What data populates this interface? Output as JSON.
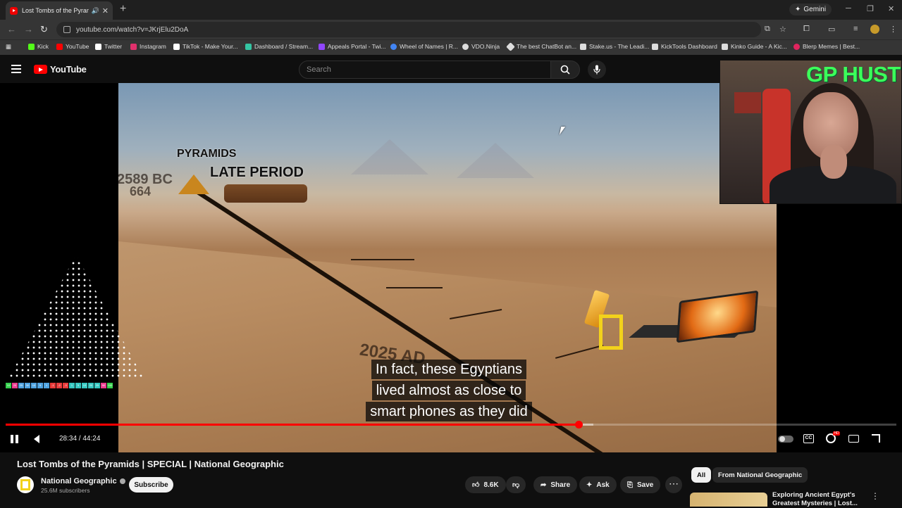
{
  "browser": {
    "tab_title": "Lost Tombs of the Pyramids",
    "gemini_label": "Gemini",
    "url": "youtube.com/watch?v=JKrjElu2DoA",
    "bookmarks": [
      {
        "label": "Kick",
        "color": "#53fc18"
      },
      {
        "label": "YouTube",
        "color": "#ff0000"
      },
      {
        "label": "Twitter",
        "color": "#ffffff"
      },
      {
        "label": "Instagram",
        "color": "#e1306c"
      },
      {
        "label": "TikTok - Make Your...",
        "color": "#ffffff"
      },
      {
        "label": "Dashboard / Stream...",
        "color": "#34c5a3"
      },
      {
        "label": "Appeals Portal - Twi...",
        "color": "#9146ff"
      },
      {
        "label": "Wheel of Names | R...",
        "color": "#4285f4"
      },
      {
        "label": "VDO.Ninja",
        "color": "#dddddd"
      },
      {
        "label": "The best ChatBot an...",
        "color": "#dddddd"
      },
      {
        "label": "Stake.us - The Leadi...",
        "color": "#dddddd"
      },
      {
        "label": "KickTools Dashboard",
        "color": "#dddddd"
      },
      {
        "label": "Kinko Guide - A Kic...",
        "color": "#dddddd"
      },
      {
        "label": "Blerp Memes | Best...",
        "color": "#e0245e"
      }
    ]
  },
  "youtube": {
    "logo_text": "YouTube",
    "search_placeholder": "Search"
  },
  "video": {
    "era_labels": [
      "PYRAMIDS",
      "LATE PERIOD"
    ],
    "year_labels": [
      "2589 BC",
      "664",
      "2025 AD"
    ],
    "subtitle_lines": [
      "In fact, these Egyptians",
      "lived almost as close to",
      "smart phones as they did"
    ],
    "current_time": "28:34",
    "duration": "44:24",
    "time_display": "28:34 / 44:24",
    "played_fraction": 0.643,
    "buffered_fraction": 0.66,
    "overlay_counters": [
      "10",
      "20",
      "25",
      "30",
      "10",
      "5",
      "1",
      "-1",
      "-2",
      "-3",
      "1",
      "5",
      "10",
      "20",
      "25",
      "50",
      "100"
    ],
    "counter_colors": [
      "#35d04d",
      "#e83b8e",
      "#4fa3e0",
      "#4fa3e0",
      "#4fa3e0",
      "#4fa3e0",
      "#4fa3e0",
      "#e83b3b",
      "#e83b3b",
      "#e83b3b",
      "#36c7c0",
      "#36c7c0",
      "#36c7c0",
      "#36c7c0",
      "#36c7c0",
      "#e83b8e",
      "#35d04d"
    ],
    "webcam_tag": "GP HUSTLA"
  },
  "video_meta": {
    "title": "Lost Tombs of the Pyramids | SPECIAL | National Geographic",
    "channel": "National Geographic",
    "subscribers": "25.6M subscribers",
    "subscribe_label": "Subscribe",
    "likes": "8.6K",
    "share_label": "Share",
    "ask_label": "Ask",
    "save_label": "Save"
  },
  "sidebar": {
    "chips": [
      "All",
      "From National Geographic"
    ],
    "recommendation": {
      "title": "Exploring Ancient Egypt's Greatest Mysteries | Lost..."
    }
  }
}
